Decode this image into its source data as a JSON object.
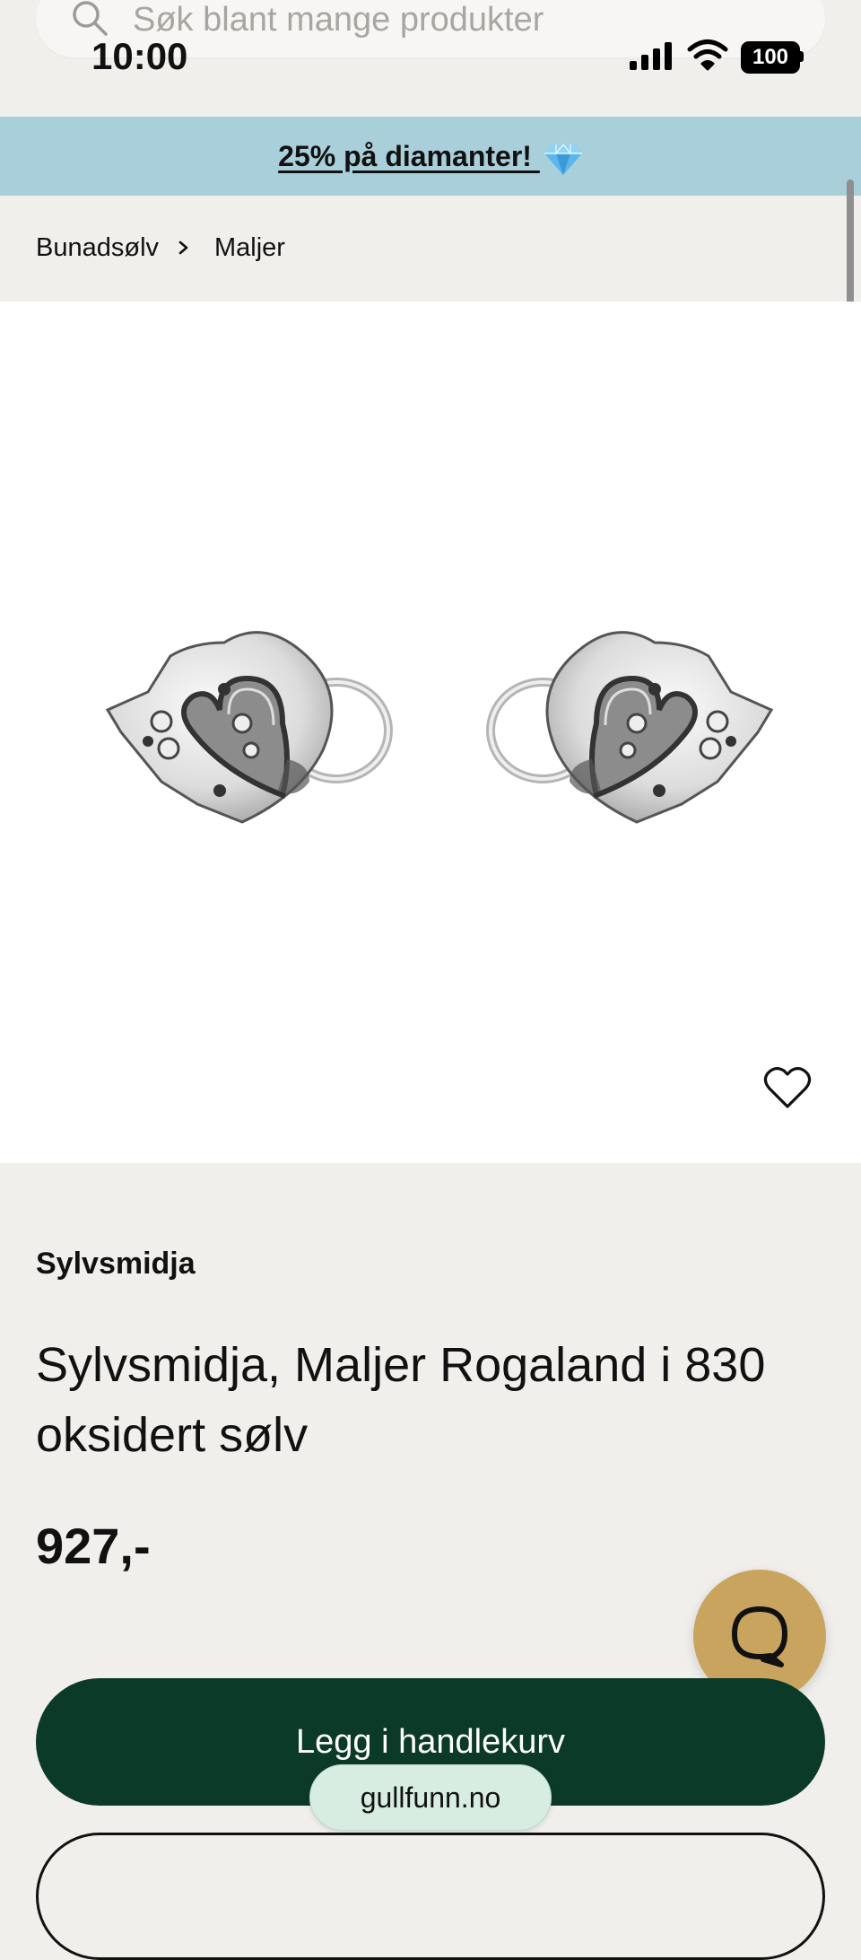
{
  "status_bar": {
    "time": "10:00",
    "battery": "100",
    "signal_icon": "cellular-signal-icon",
    "wifi_icon": "wifi-icon"
  },
  "search": {
    "placeholder": "Søk blant mange produkter",
    "icon": "search-icon"
  },
  "promo": {
    "text": "25% på diamanter! ",
    "icon": "diamond-icon",
    "background": "#a9cfda"
  },
  "breadcrumb": {
    "items": [
      "Bunadsølv",
      "Maljer"
    ]
  },
  "product": {
    "brand": "Sylvsmidja",
    "title": "Sylvsmidja, Maljer Rogaland i 830 oksidert sølv",
    "price": "927,-",
    "favorite_icon": "heart-icon"
  },
  "actions": {
    "add_to_cart": "Legg i handlekurv",
    "chat_icon": "chat-bubble-icon"
  },
  "browser": {
    "url": "gullfunn.no"
  },
  "colors": {
    "primary_button": "#0c3a28",
    "chat_button": "#c9a45e",
    "page_background": "#f1efec"
  }
}
